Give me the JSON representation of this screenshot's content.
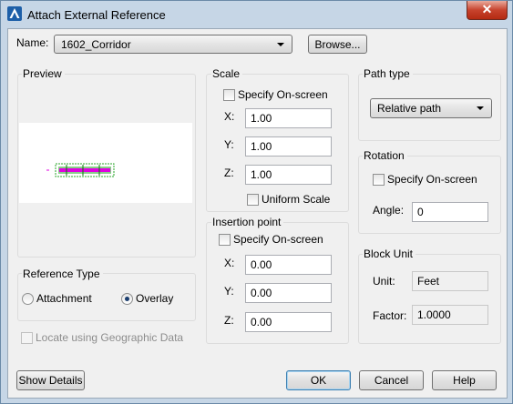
{
  "window": {
    "title": "Attach External Reference",
    "close_glyph": "✕",
    "app_icon": "autocad-icon",
    "accent": "#c7432d"
  },
  "name_row": {
    "label": "Name:",
    "value": "1602_Corridor",
    "browse_label": "Browse..."
  },
  "preview": {
    "label": "Preview",
    "thumbnail": "xref-corridor-preview",
    "accent_magenta": "#e000e0",
    "accent_green": "#2aa52a"
  },
  "reference_type": {
    "label": "Reference Type",
    "attachment_label": "Attachment",
    "overlay_label": "Overlay",
    "selected": "Overlay"
  },
  "geo": {
    "label": "Locate using Geographic Data"
  },
  "scale": {
    "label": "Scale",
    "specify_label": "Specify On-screen",
    "x_label": "X:",
    "x_value": "1.00",
    "y_label": "Y:",
    "y_value": "1.00",
    "z_label": "Z:",
    "z_value": "1.00",
    "uniform_label": "Uniform Scale"
  },
  "insertion": {
    "label": "Insertion point",
    "specify_label": "Specify On-screen",
    "x_label": "X:",
    "x_value": "0.00",
    "y_label": "Y:",
    "y_value": "0.00",
    "z_label": "Z:",
    "z_value": "0.00"
  },
  "path_type": {
    "label": "Path type",
    "value": "Relative path"
  },
  "rotation": {
    "label": "Rotation",
    "specify_label": "Specify On-screen",
    "angle_label": "Angle:",
    "angle_value": "0"
  },
  "block_unit": {
    "label": "Block Unit",
    "unit_label": "Unit:",
    "unit_value": "Feet",
    "factor_label": "Factor:",
    "factor_value": "1.0000"
  },
  "footer": {
    "details_label": "Show Details",
    "ok_label": "OK",
    "cancel_label": "Cancel",
    "help_label": "Help"
  }
}
